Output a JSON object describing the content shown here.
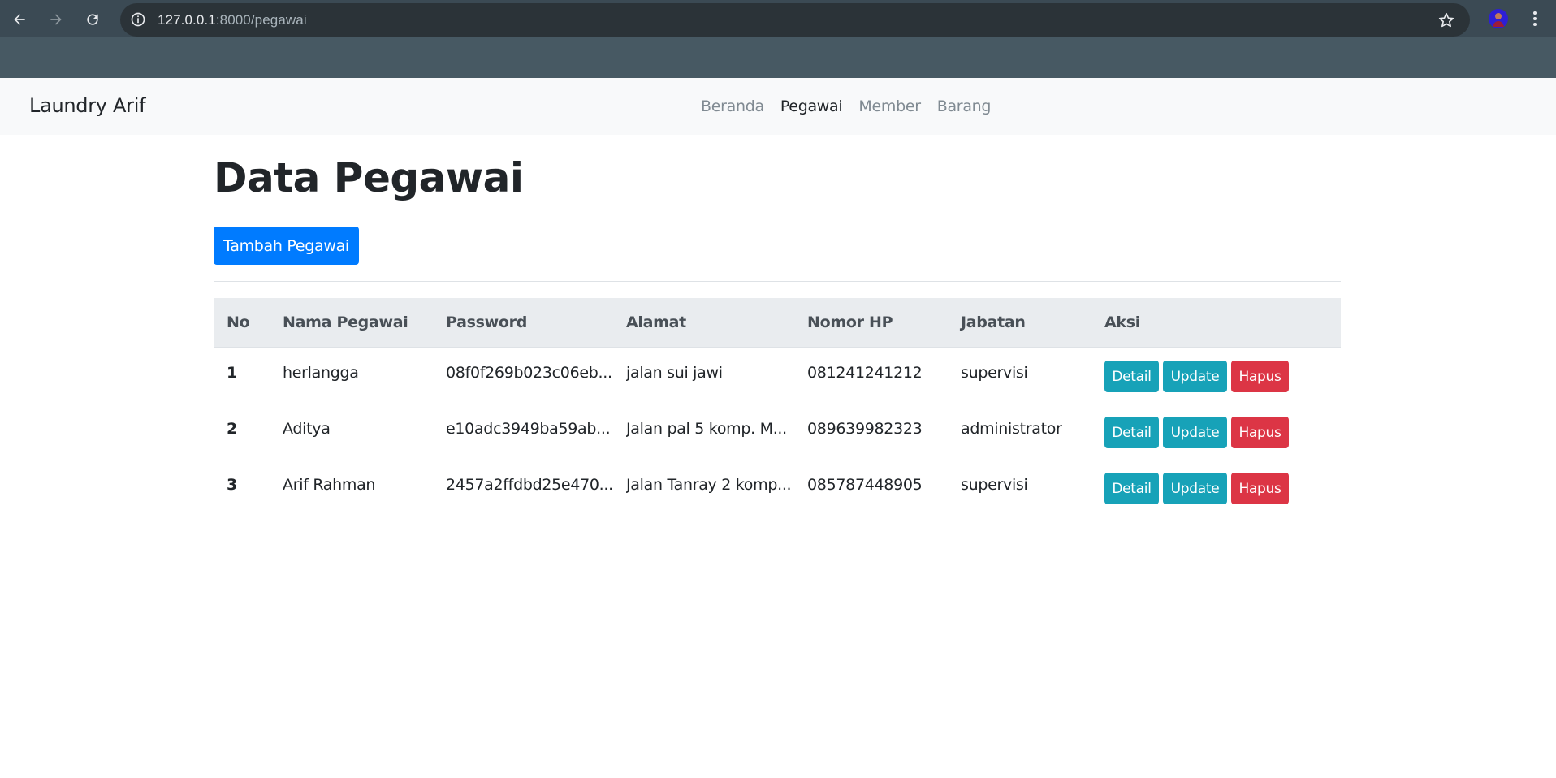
{
  "browser": {
    "url_host": "127.0.0.1",
    "url_rest": ":8000/pegawai"
  },
  "navbar": {
    "brand": "Laundry Arif",
    "links": [
      {
        "label": "Beranda",
        "active": false
      },
      {
        "label": "Pegawai",
        "active": true
      },
      {
        "label": "Member",
        "active": false
      },
      {
        "label": "Barang",
        "active": false
      }
    ]
  },
  "page": {
    "title": "Data Pegawai",
    "add_button": "Tambah Pegawai"
  },
  "table": {
    "headers": [
      "No",
      "Nama Pegawai",
      "Password",
      "Alamat",
      "Nomor HP",
      "Jabatan",
      "Aksi"
    ],
    "rows": [
      {
        "no": "1",
        "nama": "herlangga",
        "password": "08f0f269b023c06eb...",
        "alamat": "jalan sui jawi",
        "hp": "081241241212",
        "jabatan": "supervisi"
      },
      {
        "no": "2",
        "nama": "Aditya",
        "password": "e10adc3949ba59ab...",
        "alamat": "Jalan pal 5 komp. M...",
        "hp": "089639982323",
        "jabatan": "administrator"
      },
      {
        "no": "3",
        "nama": "Arif Rahman",
        "password": "2457a2ffdbd25e470...",
        "alamat": "Jalan Tanray 2 komp...",
        "hp": "085787448905",
        "jabatan": "supervisi"
      }
    ],
    "actions": {
      "detail": "Detail",
      "update": "Update",
      "hapus": "Hapus"
    }
  }
}
